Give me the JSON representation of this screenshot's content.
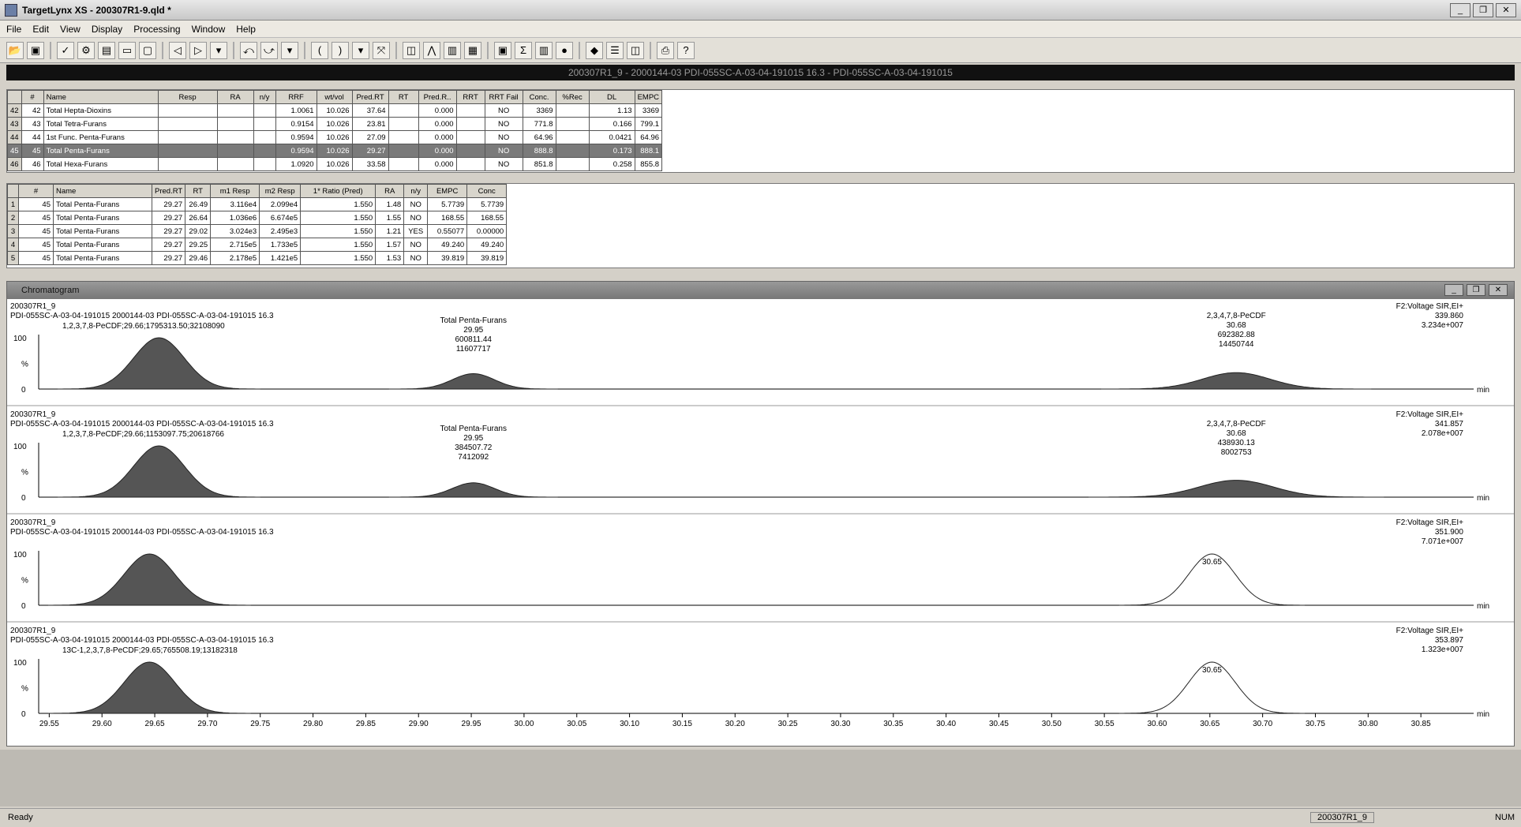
{
  "window": {
    "title": "TargetLynx XS - 200307R1-9.qld *",
    "app_icon": "targetlynx-icon"
  },
  "menu": [
    "File",
    "Edit",
    "View",
    "Display",
    "Processing",
    "Window",
    "Help"
  ],
  "caption": "200307R1_9 - 2000144-03 PDI-055SC-A-03-04-191015 16.3 - PDI-055SC-A-03-04-191015",
  "compound_table": {
    "columns": [
      "#",
      "Name",
      "Resp",
      "RA",
      "n/y",
      "RRF",
      "wt/vol",
      "Pred.RT",
      "RT",
      "Pred.R..",
      "RRT",
      "RRT Fail",
      "Conc.",
      "%Rec",
      "DL",
      "EMPC"
    ],
    "rows": [
      {
        "idx": "42",
        "num": "42",
        "name": "Total Hepta-Dioxins",
        "resp": "",
        "ra": "",
        "ny": "",
        "rrf": "1.0061",
        "wtvol": "10.026",
        "predrt": "37.64",
        "rt": "",
        "predr": "0.000",
        "rrt": "",
        "rrtfail": "NO",
        "conc": "3369",
        "rec": "",
        "dl": "1.13",
        "empc": "3369"
      },
      {
        "idx": "43",
        "num": "43",
        "name": "Total Tetra-Furans",
        "resp": "",
        "ra": "",
        "ny": "",
        "rrf": "0.9154",
        "wtvol": "10.026",
        "predrt": "23.81",
        "rt": "",
        "predr": "0.000",
        "rrt": "",
        "rrtfail": "NO",
        "conc": "771.8",
        "rec": "",
        "dl": "0.166",
        "empc": "799.1"
      },
      {
        "idx": "44",
        "num": "44",
        "name": "1st Func. Penta-Furans",
        "resp": "",
        "ra": "",
        "ny": "",
        "rrf": "0.9594",
        "wtvol": "10.026",
        "predrt": "27.09",
        "rt": "",
        "predr": "0.000",
        "rrt": "",
        "rrtfail": "NO",
        "conc": "64.96",
        "rec": "",
        "dl": "0.0421",
        "empc": "64.96"
      },
      {
        "idx": "45",
        "num": "45",
        "name": "Total Penta-Furans",
        "resp": "",
        "ra": "",
        "ny": "",
        "rrf": "0.9594",
        "wtvol": "10.026",
        "predrt": "29.27",
        "rt": "",
        "predr": "0.000",
        "rrt": "",
        "rrtfail": "NO",
        "conc": "888.8",
        "rec": "",
        "dl": "0.173",
        "empc": "888.1",
        "selected": true
      },
      {
        "idx": "46",
        "num": "46",
        "name": "Total Hexa-Furans",
        "resp": "",
        "ra": "",
        "ny": "",
        "rrf": "1.0920",
        "wtvol": "10.026",
        "predrt": "33.58",
        "rt": "",
        "predr": "0.000",
        "rrt": "",
        "rrtfail": "NO",
        "conc": "851.8",
        "rec": "",
        "dl": "0.258",
        "empc": "855.8"
      }
    ]
  },
  "peak_table": {
    "columns": [
      "#",
      "Name",
      "Pred.RT",
      "RT",
      "m1 Resp",
      "m2 Resp",
      "1* Ratio (Pred)",
      "RA",
      "n/y",
      "EMPC",
      "Conc"
    ],
    "rows": [
      {
        "idx": "1",
        "num": "45",
        "name": "Total Penta-Furans",
        "predrt": "29.27",
        "rt": "26.49",
        "m1": "3.116e4",
        "m2": "2.099e4",
        "ratio": "1.550",
        "ra": "1.48",
        "ny": "NO",
        "empc": "5.7739",
        "conc": "5.7739"
      },
      {
        "idx": "2",
        "num": "45",
        "name": "Total Penta-Furans",
        "predrt": "29.27",
        "rt": "26.64",
        "m1": "1.036e6",
        "m2": "6.674e5",
        "ratio": "1.550",
        "ra": "1.55",
        "ny": "NO",
        "empc": "168.55",
        "conc": "168.55"
      },
      {
        "idx": "3",
        "num": "45",
        "name": "Total Penta-Furans",
        "predrt": "29.27",
        "rt": "29.02",
        "m1": "3.024e3",
        "m2": "2.495e3",
        "ratio": "1.550",
        "ra": "1.21",
        "ny": "YES",
        "empc": "0.55077",
        "conc": "0.00000"
      },
      {
        "idx": "4",
        "num": "45",
        "name": "Total Penta-Furans",
        "predrt": "29.27",
        "rt": "29.25",
        "m1": "2.715e5",
        "m2": "1.733e5",
        "ratio": "1.550",
        "ra": "1.57",
        "ny": "NO",
        "empc": "49.240",
        "conc": "49.240"
      },
      {
        "idx": "5",
        "num": "45",
        "name": "Total Penta-Furans",
        "predrt": "29.27",
        "rt": "29.46",
        "m1": "2.178e5",
        "m2": "1.421e5",
        "ratio": "1.550",
        "ra": "1.53",
        "ny": "NO",
        "empc": "39.819",
        "conc": "39.819"
      }
    ]
  },
  "chromatogram": {
    "title": "Chromatogram",
    "traces": [
      {
        "sample": "200307R1_9",
        "desc": "PDI-055SC-A-03-04-191015 2000144-03 PDI-055SC-A-03-04-191015 16.3",
        "right1": "F2:Voltage SIR,EI+",
        "right2": "339.860",
        "right3": "3.234e+007",
        "ann_main": "1,2,3,7,8-PeCDF;29.66;1795313.50;32108090",
        "ann_mid": [
          "Total Penta-Furans",
          "29.95",
          "600811.44",
          "11607717"
        ],
        "ann_right": [
          "2,3,4,7,8-PeCDF",
          "30.68",
          "692382.88",
          "14450744"
        ]
      },
      {
        "sample": "200307R1_9",
        "desc": "PDI-055SC-A-03-04-191015 2000144-03 PDI-055SC-A-03-04-191015 16.3",
        "right1": "F2:Voltage SIR,EI+",
        "right2": "341.857",
        "right3": "2.078e+007",
        "ann_main": "1,2,3,7,8-PeCDF;29.66;1153097.75;20618766",
        "ann_mid": [
          "Total Penta-Furans",
          "29.95",
          "384507.72",
          "7412092"
        ],
        "ann_right": [
          "2,3,4,7,8-PeCDF",
          "30.68",
          "438930.13",
          "8002753"
        ]
      },
      {
        "sample": "200307R1_9",
        "desc": "PDI-055SC-A-03-04-191015 2000144-03 PDI-055SC-A-03-04-191015 16.3",
        "right1": "F2:Voltage SIR,EI+",
        "right2": "351.900",
        "right3": "7.071e+007",
        "ann_main": "",
        "ann_mid": [],
        "ann_right": [
          "30.65"
        ]
      },
      {
        "sample": "200307R1_9",
        "desc": "PDI-055SC-A-03-04-191015 2000144-03 PDI-055SC-A-03-04-191015 16.3",
        "right1": "F2:Voltage SIR,EI+",
        "right2": "353.897",
        "right3": "1.323e+007",
        "ann_main": "13C-1,2,3,7,8-PeCDF;29.65;765508.19;13182318",
        "ann_mid": [],
        "ann_right": [
          "30.65"
        ]
      }
    ],
    "y_ticks": [
      "100",
      "%",
      "0"
    ],
    "x_unit": "min",
    "x_ticks": [
      "29.55",
      "29.60",
      "29.65",
      "29.70",
      "29.75",
      "29.80",
      "29.85",
      "29.90",
      "29.95",
      "30.00",
      "30.05",
      "30.10",
      "30.15",
      "30.20",
      "30.25",
      "30.30",
      "30.35",
      "30.40",
      "30.45",
      "30.50",
      "30.55",
      "30.60",
      "30.65",
      "30.70",
      "30.75",
      "30.80",
      "30.85"
    ]
  },
  "status": {
    "ready": "Ready",
    "doc": "200307R1_9",
    "num": "NUM"
  }
}
